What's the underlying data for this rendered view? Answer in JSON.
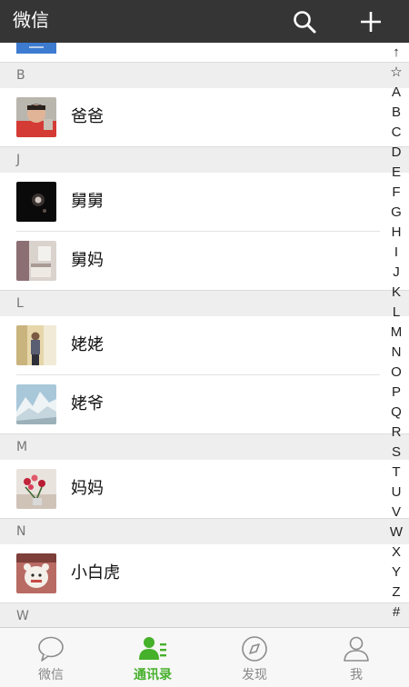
{
  "header": {
    "title": "微信",
    "search_icon": "search-icon",
    "add_icon": "plus-icon"
  },
  "sections": [
    {
      "letter": "B",
      "contacts": [
        {
          "name": "爸爸",
          "avatar": "photo-boy"
        }
      ]
    },
    {
      "letter": "J",
      "contacts": [
        {
          "name": "舅舅",
          "avatar": "photo-night"
        },
        {
          "name": "舅妈",
          "avatar": "photo-room"
        }
      ]
    },
    {
      "letter": "L",
      "contacts": [
        {
          "name": "姥姥",
          "avatar": "photo-person-indoor"
        },
        {
          "name": "姥爷",
          "avatar": "photo-mountains"
        }
      ]
    },
    {
      "letter": "M",
      "contacts": [
        {
          "name": "妈妈",
          "avatar": "photo-flowers"
        }
      ]
    },
    {
      "letter": "N",
      "contacts": [
        {
          "name": "小白虎",
          "avatar": "photo-toy-tiger"
        }
      ]
    },
    {
      "letter": "W",
      "contacts": []
    }
  ],
  "index_bar": [
    "↑",
    "☆",
    "A",
    "B",
    "C",
    "D",
    "E",
    "F",
    "G",
    "H",
    "I",
    "J",
    "K",
    "L",
    "M",
    "N",
    "O",
    "P",
    "Q",
    "R",
    "S",
    "T",
    "U",
    "V",
    "W",
    "X",
    "Y",
    "Z",
    "#"
  ],
  "tabs": [
    {
      "label": "微信",
      "icon": "chat-bubble-icon",
      "active": false
    },
    {
      "label": "通讯录",
      "icon": "contacts-icon",
      "active": true
    },
    {
      "label": "发现",
      "icon": "compass-icon",
      "active": false
    },
    {
      "label": "我",
      "icon": "person-icon",
      "active": false
    }
  ],
  "colors": {
    "header_bg": "#353535",
    "active_tab": "#45b02a",
    "section_bg": "#eeeeee"
  }
}
